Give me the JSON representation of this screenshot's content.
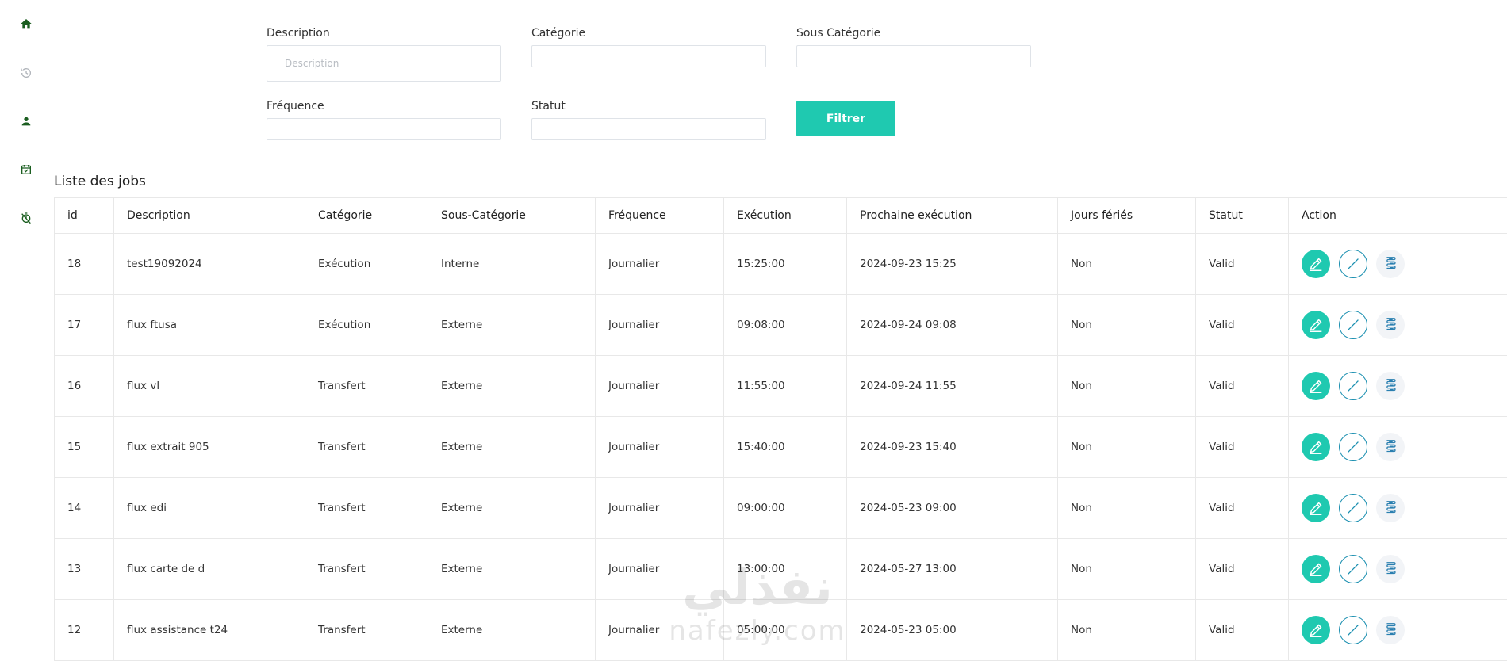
{
  "sidebar": {
    "icons": [
      "home-icon",
      "history-icon",
      "user-icon",
      "calendar-check-icon",
      "timer-off-icon"
    ]
  },
  "filters": {
    "description": {
      "label": "Description",
      "placeholder": "Description",
      "value": ""
    },
    "categorie": {
      "label": "Catégorie",
      "value": ""
    },
    "sous_categorie": {
      "label": "Sous Catégorie",
      "value": ""
    },
    "frequence": {
      "label": "Fréquence",
      "value": ""
    },
    "statut": {
      "label": "Statut",
      "value": ""
    },
    "button": "Filtrer"
  },
  "list_title": "Liste des jobs",
  "table": {
    "headers": [
      "id",
      "Description",
      "Catégorie",
      "Sous-Catégorie",
      "Fréquence",
      "Exécution",
      "Prochaine exécution",
      "Jours fériés",
      "Statut",
      "Action"
    ],
    "rows": [
      [
        "18",
        "test19092024",
        "Exécution",
        "Interne",
        "Journalier",
        "15:25:00",
        "2024-09-23 15:25",
        "Non",
        "Valid"
      ],
      [
        "17",
        "flux ftusa",
        "Exécution",
        "Externe",
        "Journalier",
        "09:08:00",
        "2024-09-24 09:08",
        "Non",
        "Valid"
      ],
      [
        "16",
        "flux vl",
        "Transfert",
        "Externe",
        "Journalier",
        "11:55:00",
        "2024-09-24 11:55",
        "Non",
        "Valid"
      ],
      [
        "15",
        "flux extrait 905",
        "Transfert",
        "Externe",
        "Journalier",
        "15:40:00",
        "2024-09-23 15:40",
        "Non",
        "Valid"
      ],
      [
        "14",
        "flux edi",
        "Transfert",
        "Externe",
        "Journalier",
        "09:00:00",
        "2024-05-23 09:00",
        "Non",
        "Valid"
      ],
      [
        "13",
        "flux carte de d",
        "Transfert",
        "Externe",
        "Journalier",
        "13:00:00",
        "2024-05-27 13:00",
        "Non",
        "Valid"
      ],
      [
        "12",
        "flux assistance t24",
        "Transfert",
        "Externe",
        "Journalier",
        "05:00:00",
        "2024-05-23 05:00",
        "Non",
        "Valid"
      ]
    ],
    "action_icons": [
      "edit-icon",
      "disable-icon",
      "log-scroll-icon"
    ]
  },
  "watermark": {
    "arabic": "نفذلي",
    "latin": "nafezly.com"
  },
  "colors": {
    "accent": "#1fc9b0",
    "sidebar_icon_active": "#1b5e20",
    "disable_ring": "#1a8fb0"
  }
}
